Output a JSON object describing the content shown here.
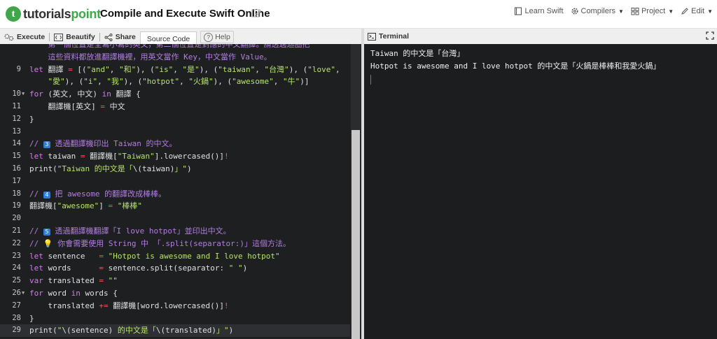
{
  "header": {
    "logo_mark": "t",
    "logo_part1": "tutorials",
    "logo_part2": "point",
    "title": "Compile and Execute Swift Online",
    "nav": [
      {
        "label": "Learn Swift",
        "icon": "book-icon"
      },
      {
        "label": "Compilers",
        "icon": "gear-icon",
        "dropdown": true
      },
      {
        "label": "Project",
        "icon": "folder-icon",
        "dropdown": true
      },
      {
        "label": "Edit",
        "icon": "pencil-icon",
        "dropdown": true
      }
    ]
  },
  "toolbar": {
    "execute": "Execute",
    "beautify": "Beautify",
    "share": "Share",
    "source_code": "Source Code",
    "help": "Help"
  },
  "terminal": {
    "title": "Terminal",
    "output": [
      "Taiwan 的中文是「台灣」",
      "Hotpot is awesome and I love hotpot 的中文是「火鍋是棒棒和我愛火鍋」"
    ]
  },
  "editor": {
    "line_numbers": [
      "",
      "",
      "9",
      "",
      "10",
      "11",
      "12",
      "13",
      "14",
      "15",
      "16",
      "17",
      "18",
      "19",
      "20",
      "21",
      "22",
      "23",
      "24",
      "25",
      "26",
      "27",
      "28",
      "29"
    ],
    "comment_wrap_1": "    第一個位置是全寫小寫的英文，第二個位置是對應的中文翻譯。請透過迴圈把",
    "comment_wrap_2": "    這些資料都放進翻譯機裡，用英文當作 Key，中文當作 Value。",
    "l9_a": "let",
    "l9_b": " 翻譯 ",
    "l9_c": "=",
    "l9_d": " [(",
    "l9_pairs1": "\"and\"",
    "l9_pairs2": "\"和\"",
    "l9_pairs3": "\"is\"",
    "l9_pairs4": "\"是\"",
    "l9_pairs5": "\"taiwan\"",
    "l9_pairs6": "\"台灣\"",
    "l9_pairs7": "\"love\"",
    "l9w_1": "\"愛\"",
    "l9w_2": "\"i\"",
    "l9w_3": "\"我\"",
    "l9w_4": "\"hotpot\"",
    "l9w_5": "\"火鍋\"",
    "l9w_6": "\"awesome\"",
    "l9w_7": "\"牛\"",
    "l10_for": "for",
    "l10_vars": " (英文, 中文) ",
    "l10_in": "in",
    "l10_rest": " 翻譯 {",
    "l11_a": "    翻譯機[英文] ",
    "l11_eq": "=",
    "l11_b": " 中文",
    "l12": "}",
    "l14_a": "// ",
    "l14_n": "3",
    "l14_b": " 透過翻譯機印出 Taiwan 的中文。",
    "l15_let": "let",
    "l15_a": " taiwan ",
    "l15_eq": "=",
    "l15_b": " 翻譯機[",
    "l15_str": "\"Taiwan\"",
    "l15_c": "].lowercased()]",
    "l15_bang": "!",
    "l16_a": "print(",
    "l16_str1": "\"Taiwan 的中文是「",
    "l16_interp": "\\(taiwan)",
    "l16_str2": "」\"",
    "l16_b": ")",
    "l18_a": "// ",
    "l18_n": "4",
    "l18_b": " 把 awesome 的翻譯改成棒棒。",
    "l19_a": "翻譯機[",
    "l19_str": "\"awesome\"",
    "l19_b": "] ",
    "l19_eq": "=",
    "l19_str2": " \"棒棒\"",
    "l21_a": "// ",
    "l21_n": "5",
    "l21_b": " 透過翻譯機翻譯「I love hotpot」並印出中文。",
    "l22_a": "// ",
    "l22_bulb": "💡",
    "l22_b": " 你會需要使用 String 中 「.split(separator:)」這個方法。",
    "l23_let": "let",
    "l23_a": " sentence   ",
    "l23_eq": "=",
    "l23_str": " \"Hotpot is awesome and I love hotpot\"",
    "l24_let": "let",
    "l24_a": " words      ",
    "l24_eq": "=",
    "l24_b": " sentence.split(separator: ",
    "l24_str": "\" \"",
    "l24_c": ")",
    "l25_var": "var",
    "l25_a": " translated ",
    "l25_eq": "=",
    "l25_str": " \"\"",
    "l26_for": "for",
    "l26_a": " word ",
    "l26_in": "in",
    "l26_b": " words {",
    "l27_a": "    translated ",
    "l27_eq": "+=",
    "l27_b": " 翻譯機[word.lowercased()]",
    "l27_bang": "!",
    "l28": "}",
    "l29_a": "print(",
    "l29_str1": "\"",
    "l29_i1": "\\(sentence)",
    "l29_str2": " 的中文是「",
    "l29_i2": "\\(translated)",
    "l29_str3": "」\"",
    "l29_b": ")"
  },
  "colors": {
    "brand_green": "#3fa74a",
    "editor_bg": "#1d1f21",
    "keyword": "#d977f0",
    "string": "#b7e36b",
    "comment": "#b37ee0"
  }
}
